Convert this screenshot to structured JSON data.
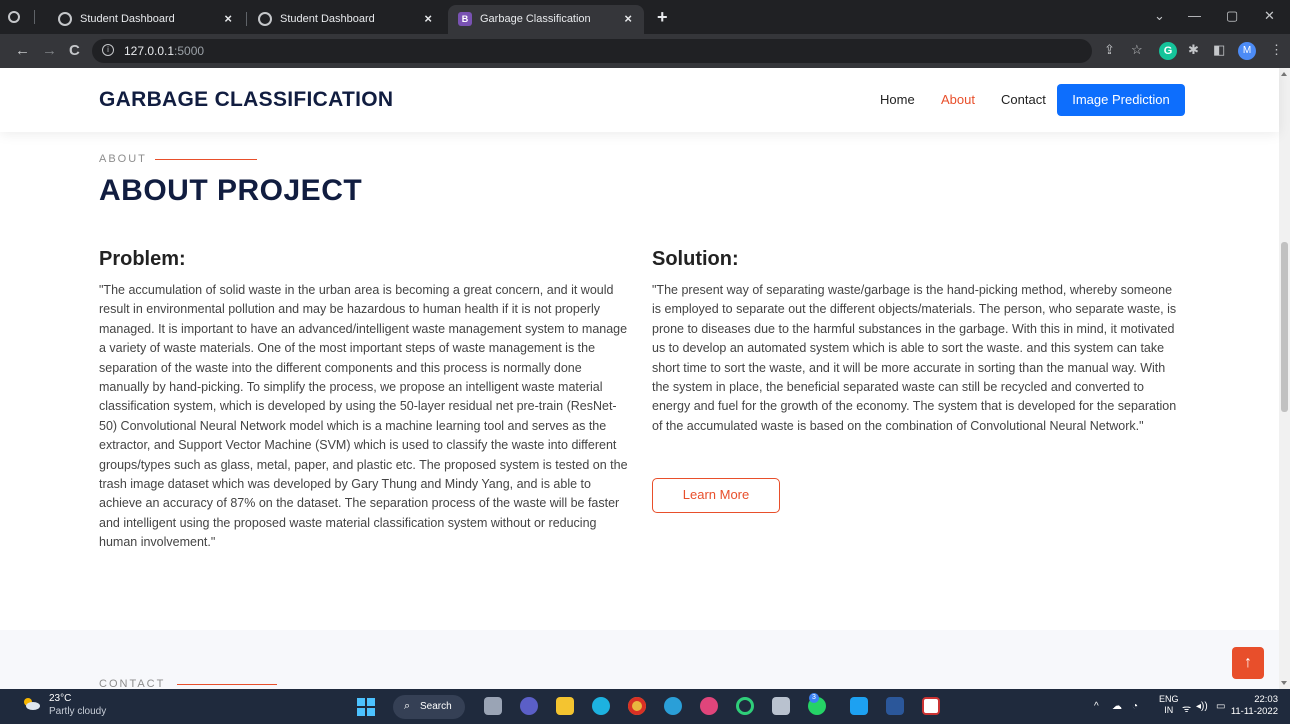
{
  "browser": {
    "tabs": [
      {
        "title": "Student Dashboard",
        "active": false
      },
      {
        "title": "Student Dashboard",
        "active": false
      },
      {
        "title": "Garbage Classification",
        "active": true
      }
    ],
    "tab_close_glyph": "×",
    "new_tab_glyph": "+",
    "url_host": "127.0.0.1",
    "url_port": ":5000",
    "back_glyph": "←",
    "forward_glyph": "→",
    "reload_glyph": "C",
    "avatar_letter": "M",
    "grammarly_letter": "G",
    "window_controls": {
      "minimize": "—",
      "restore": "▢",
      "close": "✕",
      "dropdown": "⌄"
    }
  },
  "site": {
    "logo": "GARBAGE CLASSIFICATION",
    "nav": [
      {
        "label": "Home",
        "active": false
      },
      {
        "label": "About",
        "active": true
      },
      {
        "label": "Contact",
        "active": false
      }
    ],
    "cta_label": "Image Prediction",
    "about_eyebrow": "ABOUT",
    "about_title": "ABOUT PROJECT",
    "problem_heading": "Problem:",
    "problem_text": "\"The accumulation of solid waste in the urban area is becoming a great concern, and it would result in environmental pollution and may be hazardous to human health if it is not properly managed. It is important to have an advanced/intelligent waste management system to manage a variety of waste materials. One of the most important steps of waste management is the separation of the waste into the different components and this process is normally done manually by hand-picking. To simplify the process, we propose an intelligent waste material classification system, which is developed by using the 50-layer residual net pre-train (ResNet-50) Convolutional Neural Network model which is a machine learning tool and serves as the extractor, and Support Vector Machine (SVM) which is used to classify the waste into different groups/types such as glass, metal, paper, and plastic etc. The proposed system is tested on the trash image dataset which was developed by Gary Thung and Mindy Yang, and is able to achieve an accuracy of 87% on the dataset. The separation process of the waste will be faster and intelligent using the proposed waste material classification system without or reducing human involvement.\"",
    "solution_heading": "Solution:",
    "solution_text": "\"The present way of separating waste/garbage is the hand-picking method, whereby someone is employed to separate out the different objects/materials. The person, who separate waste, is prone to diseases due to the harmful substances in the garbage. With this in mind, it motivated us to develop an automated system which is able to sort the waste. and this system can take short time to sort the waste, and it will be more accurate in sorting than the manual way. With the system in place, the beneficial separated waste can still be recycled and converted to energy and fuel for the growth of the economy. The system that is developed for the separation of the accumulated waste is based on the combination of Convolutional Neural Network.\"",
    "learn_more_label": "Learn More",
    "contact_eyebrow": "CONTACT",
    "back_to_top_glyph": "↑",
    "accent_color": "#e84f2b",
    "primary_color": "#0d6efd",
    "heading_color": "#111d40"
  },
  "taskbar": {
    "weather_temp": "23°C",
    "weather_desc": "Partly cloudy",
    "search_label": "Search",
    "search_glyph": "⌕",
    "teams_badge": "3",
    "lang_line1": "ENG",
    "lang_line2": "IN",
    "time": "22:03",
    "date": "11-11-2022",
    "tray_chevron": "^",
    "tray_wifi": "ᯤ",
    "tray_volume": "◂))",
    "tray_battery": "▭"
  }
}
